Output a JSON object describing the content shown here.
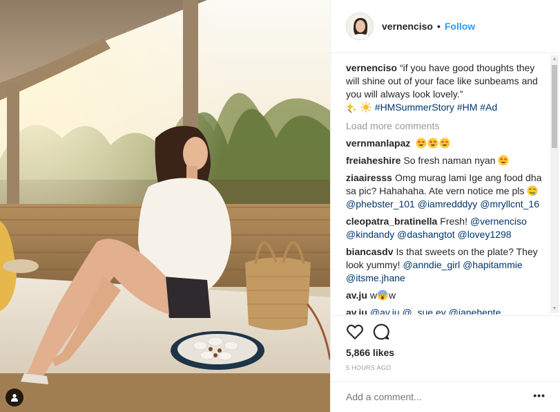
{
  "post": {
    "username": "vernenciso",
    "follow_label": "Follow",
    "dot": "•"
  },
  "caption": {
    "author": "vernenciso",
    "text": "“if you have good thoughts they will shine out of your face like sunbeams and you will always look lovely.”",
    "hashtags": [
      "#HMSummerStory",
      "#HM",
      "#Ad"
    ]
  },
  "load_more_label": "Load more comments",
  "comments": [
    {
      "author": "vernmanlapaz",
      "text": "",
      "emoji_count": 3
    },
    {
      "author": "freiaheshire",
      "text": "So fresh naman nyan",
      "emoji_count": 1
    },
    {
      "author": "ziaairesss",
      "text": "Omg murag lami Ige ang food dha sa pic? Hahahaha. Ate vern notice me pls",
      "mentions": [
        "@phebster_101",
        "@iamredddyy",
        "@mryllcnt_16"
      ]
    },
    {
      "author": "cleopatra_bratinella",
      "text": "Fresh!",
      "mentions": [
        "@vernenciso",
        "@kindandy",
        "@dashangtot",
        "@lovey1298"
      ]
    },
    {
      "author": "biancasdv",
      "text": "Is that sweets on the plate? They look yummy!",
      "mentions": [
        "@anndie_girl",
        "@hapitammie",
        "@itsme.jhane"
      ]
    },
    {
      "author": "av.ju",
      "text_before": "w",
      "text_after": "w"
    },
    {
      "author": "av.ju",
      "partial": "@av.ju @_sue.ey @janehente"
    }
  ],
  "stats": {
    "likes": "5,866 likes",
    "time": "5 HOURS AGO"
  },
  "add_comment_placeholder": "Add a comment...",
  "more_options": "•••",
  "icons": {
    "like": "heart-icon",
    "comment": "speech-bubble-icon",
    "tag": "user-tag-icon"
  },
  "colors": {
    "link": "#003569",
    "follow": "#3897f0",
    "muted": "#999999"
  }
}
